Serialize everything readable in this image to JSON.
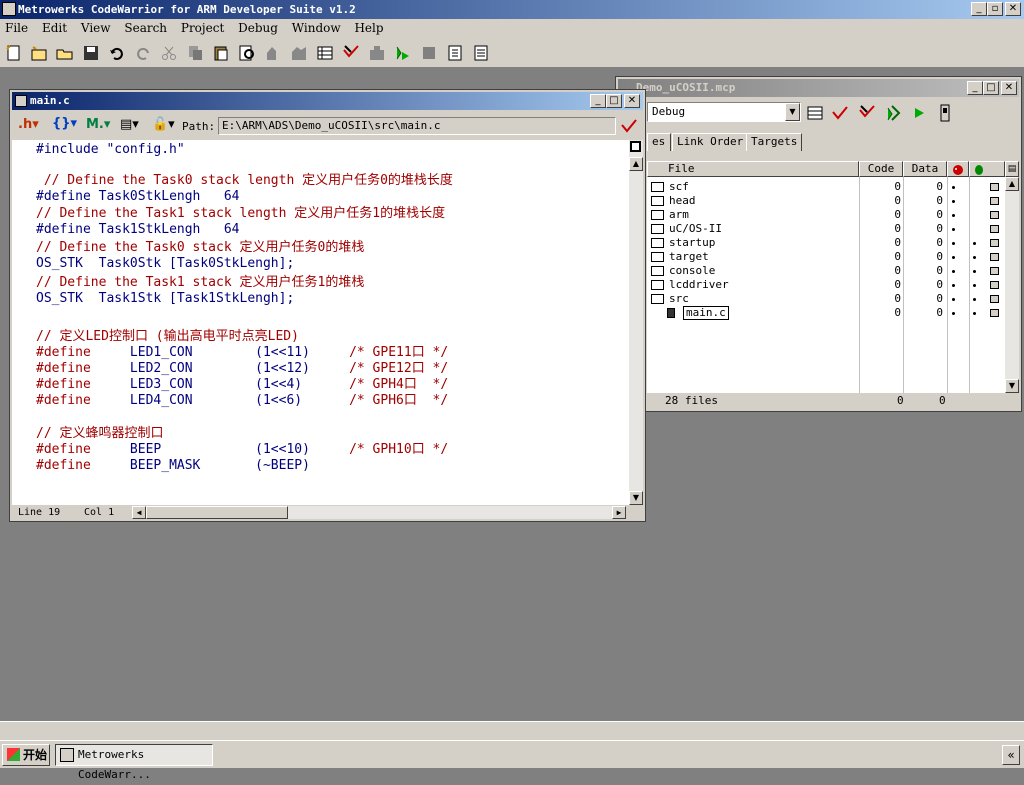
{
  "app": {
    "title": "Metrowerks CodeWarrior for ARM Developer Suite v1.2",
    "menus": [
      "File",
      "Edit",
      "View",
      "Search",
      "Project",
      "Debug",
      "Window",
      "Help"
    ]
  },
  "editor": {
    "title": "main.c",
    "path_label": "Path:",
    "path": "E:\\ARM\\ADS\\Demo_uCOSII\\src\\main.c",
    "lines": [
      {
        "parts": [
          {
            "t": "#include \"config.h\"",
            "c": "kw"
          }
        ]
      },
      {
        "parts": []
      },
      {
        "parts": [
          {
            "t": " // Define the Task0 stack length 定义用户任务0的堆栈长度",
            "c": "cm"
          }
        ]
      },
      {
        "parts": [
          {
            "t": "#define",
            "c": "kw"
          },
          {
            "t": " Task0StkLengh   64",
            "c": "kw"
          }
        ]
      },
      {
        "parts": [
          {
            "t": "// Define the Task1 stack length 定义用户任务1的堆栈长度",
            "c": "cm"
          }
        ]
      },
      {
        "parts": [
          {
            "t": "#define",
            "c": "kw"
          },
          {
            "t": " Task1StkLengh   64",
            "c": "kw"
          }
        ]
      },
      {
        "parts": [
          {
            "t": "// Define the Task0 stack 定义用户任务0的堆栈",
            "c": "cm"
          }
        ]
      },
      {
        "parts": [
          {
            "t": "OS_STK  Task0Stk [Task0StkLengh];",
            "c": "kw"
          }
        ]
      },
      {
        "parts": [
          {
            "t": "// Define the Task1 stack 定义用户任务1的堆栈",
            "c": "cm"
          }
        ]
      },
      {
        "parts": [
          {
            "t": "OS_STK  Task1Stk [Task1StkLengh];",
            "c": "kw"
          }
        ]
      },
      {
        "parts": []
      },
      {
        "parts": [
          {
            "t": "// 定义LED控制口 (输出高电平时点亮LED)",
            "c": "cm"
          }
        ]
      },
      {
        "parts": [
          {
            "t": "#define",
            "c": "cm"
          },
          {
            "t": "     LED1_CON        (1<<11)     ",
            "c": "kw"
          },
          {
            "t": "/* GPE11口 */",
            "c": "cm"
          }
        ]
      },
      {
        "parts": [
          {
            "t": "#define",
            "c": "cm"
          },
          {
            "t": "     LED2_CON        (1<<12)     ",
            "c": "kw"
          },
          {
            "t": "/* GPE12口 */",
            "c": "cm"
          }
        ]
      },
      {
        "parts": [
          {
            "t": "#define",
            "c": "cm"
          },
          {
            "t": "     LED3_CON        (1<<4)      ",
            "c": "kw"
          },
          {
            "t": "/* GPH4口  */",
            "c": "cm"
          }
        ]
      },
      {
        "parts": [
          {
            "t": "#define",
            "c": "cm"
          },
          {
            "t": "     LED4_CON        (1<<6)      ",
            "c": "kw"
          },
          {
            "t": "/* GPH6口  */",
            "c": "cm"
          }
        ]
      },
      {
        "parts": []
      },
      {
        "parts": [
          {
            "t": "// 定义蜂鸣器控制口",
            "c": "cm"
          }
        ]
      },
      {
        "parts": [
          {
            "t": "#define",
            "c": "cm"
          },
          {
            "t": "     BEEP            (1<<10)     ",
            "c": "kw"
          },
          {
            "t": "/* GPH10口 */",
            "c": "cm"
          }
        ]
      },
      {
        "parts": [
          {
            "t": "#define",
            "c": "cm"
          },
          {
            "t": "     BEEP_MASK       (~BEEP)",
            "c": "kw"
          }
        ]
      }
    ],
    "status_line": "Line 19",
    "status_col": "Col 1"
  },
  "project": {
    "title": "Demo_uCOSII.mcp",
    "target": "Debug",
    "tabs": [
      "es",
      "Link Order",
      "Targets"
    ],
    "columns": {
      "file": "File",
      "code": "Code",
      "data": "Data"
    },
    "files": [
      {
        "name": "scf",
        "code": "0",
        "data": "0",
        "dbg": true,
        "obj": false
      },
      {
        "name": "head",
        "code": "0",
        "data": "0",
        "dbg": true,
        "obj": false
      },
      {
        "name": "arm",
        "code": "0",
        "data": "0",
        "dbg": true,
        "obj": false
      },
      {
        "name": "uC/OS-II",
        "code": "0",
        "data": "0",
        "dbg": true,
        "obj": false
      },
      {
        "name": "startup",
        "code": "0",
        "data": "0",
        "dbg": true,
        "obj": true
      },
      {
        "name": "target",
        "code": "0",
        "data": "0",
        "dbg": true,
        "obj": true
      },
      {
        "name": "console",
        "code": "0",
        "data": "0",
        "dbg": true,
        "obj": true
      },
      {
        "name": "lcddriver",
        "code": "0",
        "data": "0",
        "dbg": true,
        "obj": true
      },
      {
        "name": "src",
        "code": "0",
        "data": "0",
        "dbg": true,
        "obj": true
      },
      {
        "name": "main.c",
        "code": "0",
        "data": "0",
        "dbg": true,
        "obj": true
      }
    ],
    "footer_count": "28 files",
    "footer_code": "0",
    "footer_data": "0"
  },
  "taskbar": {
    "start": "开始",
    "task": "Metrowerks CodeWarr..."
  }
}
